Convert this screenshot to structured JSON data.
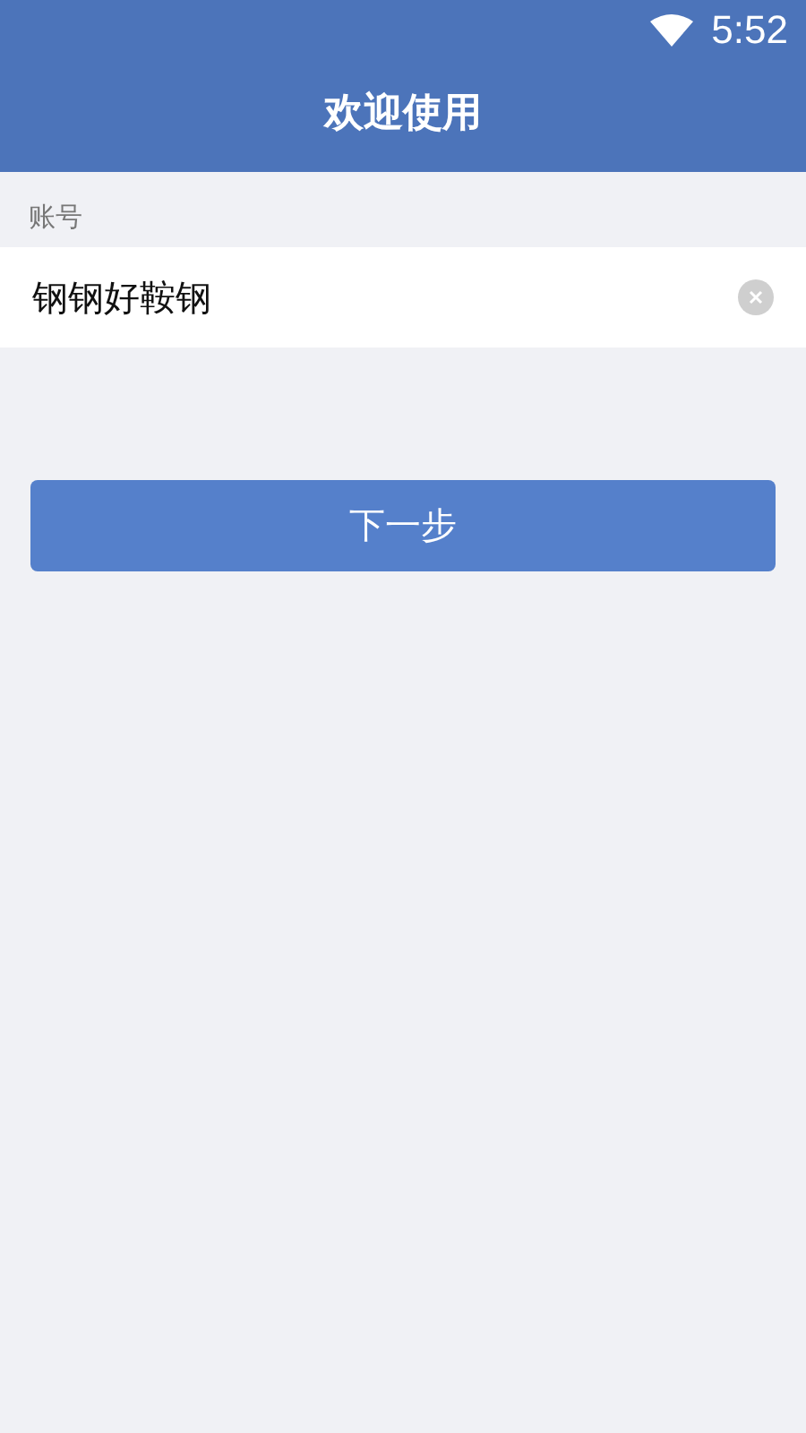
{
  "status_bar": {
    "time": "5:52"
  },
  "header": {
    "title": "欢迎使用"
  },
  "account": {
    "label": "账号",
    "value": "钢钢好鞍钢"
  },
  "buttons": [
    "下一步"
  ]
}
